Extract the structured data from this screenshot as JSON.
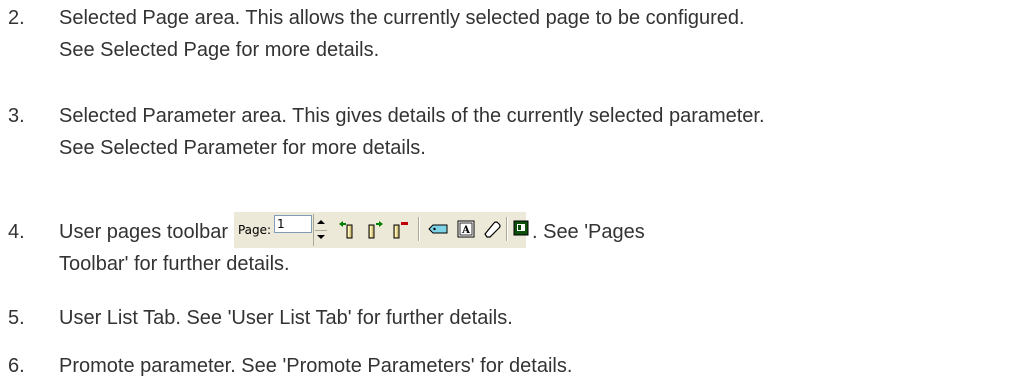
{
  "items": [
    {
      "number": "2.",
      "lines": [
        "Selected Page area. This allows the currently selected page to be configured.",
        "See Selected Page for more details."
      ]
    },
    {
      "number": "3.",
      "lines": [
        "Selected Parameter area. This gives details of the currently selected parameter.",
        "See Selected Parameter for more details."
      ]
    },
    {
      "number": "4.",
      "before_toolbar": "User pages toolbar",
      "after_toolbar": ". See 'Pages",
      "line2": "Toolbar' for further details.",
      "toolbar": {
        "page_label": "Page:",
        "page_value": "1",
        "icons": [
          "insert-page-before-icon",
          "insert-page-after-icon",
          "delete-page-icon",
          "tag-icon",
          "text-box-icon",
          "eraser-icon",
          "view-icon"
        ]
      }
    },
    {
      "number": "5.",
      "lines": [
        "User List Tab. See 'User List Tab' for further details."
      ]
    },
    {
      "number": "6.",
      "lines": [
        "Promote parameter. See 'Promote Parameters' for details."
      ]
    }
  ]
}
